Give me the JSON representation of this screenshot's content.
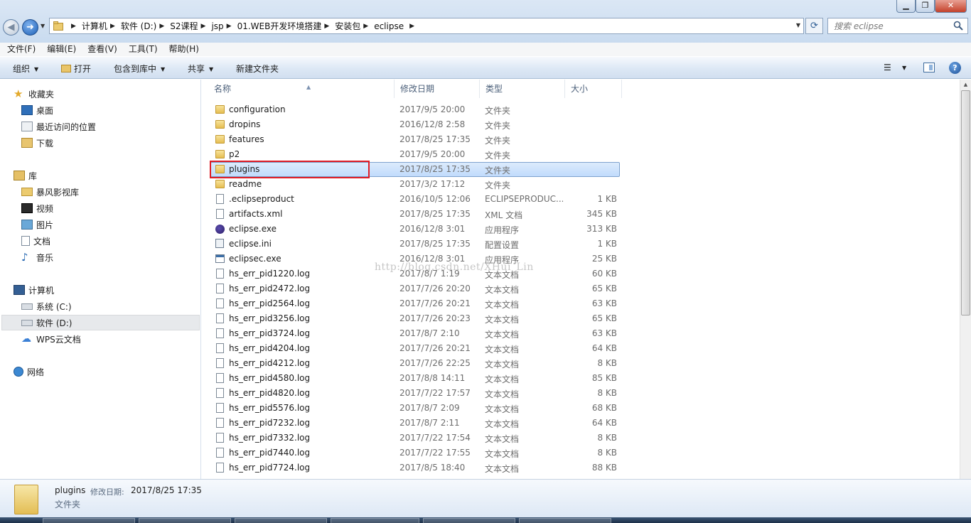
{
  "window": {
    "min_icon": "minimize-icon",
    "max_icon": "maximize-icon",
    "close_icon": "close-icon",
    "close_color": "#c4412a"
  },
  "address": {
    "crumbs": [
      "计算机",
      "软件 (D:)",
      "S2课程",
      "jsp",
      "01.WEB开发环境搭建",
      "安装包",
      "eclipse"
    ]
  },
  "search": {
    "placeholder": "搜索 eclipse"
  },
  "menu": [
    "文件(F)",
    "编辑(E)",
    "查看(V)",
    "工具(T)",
    "帮助(H)"
  ],
  "toolbar": {
    "organize": "组织",
    "open": "打开",
    "include": "包含到库中",
    "share": "共享",
    "new_folder": "新建文件夹"
  },
  "nav": {
    "favorites": "收藏夹",
    "desktop": "桌面",
    "recent": "最近访问的位置",
    "downloads": "下载",
    "libraries": "库",
    "baofeng": "暴风影视库",
    "videos": "视频",
    "pictures": "图片",
    "documents": "文档",
    "music": "音乐",
    "computer": "计算机",
    "drive_c": "系统 (C:)",
    "drive_d": "软件 (D:)",
    "wps": "WPS云文档",
    "network": "网络"
  },
  "columns": {
    "name": "名称",
    "date": "修改日期",
    "type": "类型",
    "size": "大小"
  },
  "files": [
    {
      "name": "configuration",
      "date": "2017/9/5 20:00",
      "type": "文件夹",
      "size": "",
      "icon": "folder"
    },
    {
      "name": "dropins",
      "date": "2016/12/8 2:58",
      "type": "文件夹",
      "size": "",
      "icon": "folder"
    },
    {
      "name": "features",
      "date": "2017/8/25 17:35",
      "type": "文件夹",
      "size": "",
      "icon": "folder"
    },
    {
      "name": "p2",
      "date": "2017/9/5 20:00",
      "type": "文件夹",
      "size": "",
      "icon": "folder"
    },
    {
      "name": "plugins",
      "date": "2017/8/25 17:35",
      "type": "文件夹",
      "size": "",
      "icon": "folder",
      "selected": true
    },
    {
      "name": "readme",
      "date": "2017/3/2 17:12",
      "type": "文件夹",
      "size": "",
      "icon": "folder"
    },
    {
      "name": ".eclipseproduct",
      "date": "2016/10/5 12:06",
      "type": "ECLIPSEPRODUC...",
      "size": "1 KB",
      "icon": "file"
    },
    {
      "name": "artifacts.xml",
      "date": "2017/8/25 17:35",
      "type": "XML 文档",
      "size": "345 KB",
      "icon": "file"
    },
    {
      "name": "eclipse.exe",
      "date": "2016/12/8 3:01",
      "type": "应用程序",
      "size": "313 KB",
      "icon": "exe"
    },
    {
      "name": "eclipse.ini",
      "date": "2017/8/25 17:35",
      "type": "配置设置",
      "size": "1 KB",
      "icon": "ini"
    },
    {
      "name": "eclipsec.exe",
      "date": "2016/12/8 3:01",
      "type": "应用程序",
      "size": "25 KB",
      "icon": "exec"
    },
    {
      "name": "hs_err_pid1220.log",
      "date": "2017/8/7 1:19",
      "type": "文本文档",
      "size": "60 KB",
      "icon": "file"
    },
    {
      "name": "hs_err_pid2472.log",
      "date": "2017/7/26 20:20",
      "type": "文本文档",
      "size": "65 KB",
      "icon": "file"
    },
    {
      "name": "hs_err_pid2564.log",
      "date": "2017/7/26 20:21",
      "type": "文本文档",
      "size": "63 KB",
      "icon": "file"
    },
    {
      "name": "hs_err_pid3256.log",
      "date": "2017/7/26 20:23",
      "type": "文本文档",
      "size": "65 KB",
      "icon": "file"
    },
    {
      "name": "hs_err_pid3724.log",
      "date": "2017/8/7 2:10",
      "type": "文本文档",
      "size": "63 KB",
      "icon": "file"
    },
    {
      "name": "hs_err_pid4204.log",
      "date": "2017/7/26 20:21",
      "type": "文本文档",
      "size": "64 KB",
      "icon": "file"
    },
    {
      "name": "hs_err_pid4212.log",
      "date": "2017/7/26 22:25",
      "type": "文本文档",
      "size": "8 KB",
      "icon": "file"
    },
    {
      "name": "hs_err_pid4580.log",
      "date": "2017/8/8 14:11",
      "type": "文本文档",
      "size": "85 KB",
      "icon": "file"
    },
    {
      "name": "hs_err_pid4820.log",
      "date": "2017/7/22 17:57",
      "type": "文本文档",
      "size": "8 KB",
      "icon": "file"
    },
    {
      "name": "hs_err_pid5576.log",
      "date": "2017/8/7 2:09",
      "type": "文本文档",
      "size": "68 KB",
      "icon": "file"
    },
    {
      "name": "hs_err_pid7232.log",
      "date": "2017/8/7 2:11",
      "type": "文本文档",
      "size": "64 KB",
      "icon": "file"
    },
    {
      "name": "hs_err_pid7332.log",
      "date": "2017/7/22 17:54",
      "type": "文本文档",
      "size": "8 KB",
      "icon": "file"
    },
    {
      "name": "hs_err_pid7440.log",
      "date": "2017/7/22 17:55",
      "type": "文本文档",
      "size": "8 KB",
      "icon": "file"
    },
    {
      "name": "hs_err_pid7724.log",
      "date": "2017/8/5 18:40",
      "type": "文本文档",
      "size": "88 KB",
      "icon": "file"
    }
  ],
  "highlight_color": "#e01b24",
  "watermark": "http://blog.csdn.net/XHui_Lin",
  "details": {
    "name": "plugins",
    "mod_label": "修改日期:",
    "mod_date": "2017/8/25 17:35",
    "type": "文件夹"
  }
}
